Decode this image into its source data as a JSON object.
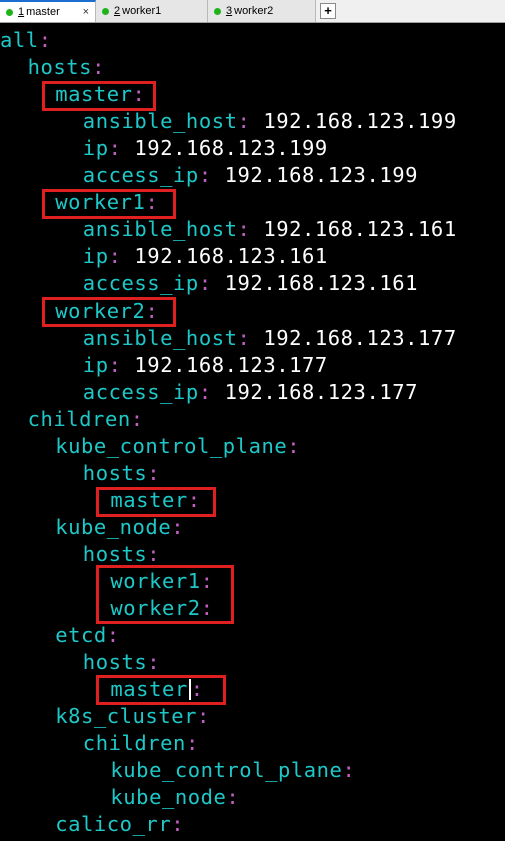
{
  "tabs": [
    {
      "num": "1",
      "label": "master",
      "active": true
    },
    {
      "num": "2",
      "label": "worker1",
      "active": false
    },
    {
      "num": "3",
      "label": "worker2",
      "active": false
    }
  ],
  "tab_close_symbol": "×",
  "add_tab_symbol": "+",
  "status_dot_color": "#1db31d",
  "highlight_color": "#e02020",
  "colors": {
    "key": "#1fc8c8",
    "colon": "#c060c0",
    "value": "#ffffff",
    "background": "#000000"
  },
  "lines": [
    {
      "indent": 0,
      "key": "all",
      "value": ""
    },
    {
      "indent": 1,
      "key": "hosts",
      "value": ""
    },
    {
      "indent": 2,
      "key": "master",
      "value": ""
    },
    {
      "indent": 3,
      "key": "ansible_host",
      "value": "192.168.123.199"
    },
    {
      "indent": 3,
      "key": "ip",
      "value": "192.168.123.199"
    },
    {
      "indent": 3,
      "key": "access_ip",
      "value": "192.168.123.199"
    },
    {
      "indent": 2,
      "key": "worker1",
      "value": ""
    },
    {
      "indent": 3,
      "key": "ansible_host",
      "value": "192.168.123.161"
    },
    {
      "indent": 3,
      "key": "ip",
      "value": "192.168.123.161"
    },
    {
      "indent": 3,
      "key": "access_ip",
      "value": "192.168.123.161"
    },
    {
      "indent": 2,
      "key": "worker2",
      "value": ""
    },
    {
      "indent": 3,
      "key": "ansible_host",
      "value": "192.168.123.177"
    },
    {
      "indent": 3,
      "key": "ip",
      "value": "192.168.123.177"
    },
    {
      "indent": 3,
      "key": "access_ip",
      "value": "192.168.123.177"
    },
    {
      "indent": 1,
      "key": "children",
      "value": ""
    },
    {
      "indent": 2,
      "key": "kube_control_plane",
      "value": ""
    },
    {
      "indent": 3,
      "key": "hosts",
      "value": ""
    },
    {
      "indent": 4,
      "key": "master",
      "value": ""
    },
    {
      "indent": 2,
      "key": "kube_node",
      "value": ""
    },
    {
      "indent": 3,
      "key": "hosts",
      "value": ""
    },
    {
      "indent": 4,
      "key": "worker1",
      "value": ""
    },
    {
      "indent": 4,
      "key": "worker2",
      "value": ""
    },
    {
      "indent": 2,
      "key": "etcd",
      "value": ""
    },
    {
      "indent": 3,
      "key": "hosts",
      "value": ""
    },
    {
      "indent": 4,
      "key": "master",
      "value": "",
      "cursor": true
    },
    {
      "indent": 2,
      "key": "k8s_cluster",
      "value": ""
    },
    {
      "indent": 3,
      "key": "children",
      "value": ""
    },
    {
      "indent": 4,
      "key": "kube_control_plane",
      "value": ""
    },
    {
      "indent": 4,
      "key": "kube_node",
      "value": ""
    },
    {
      "indent": 2,
      "key": "calico_rr",
      "value": ""
    }
  ]
}
